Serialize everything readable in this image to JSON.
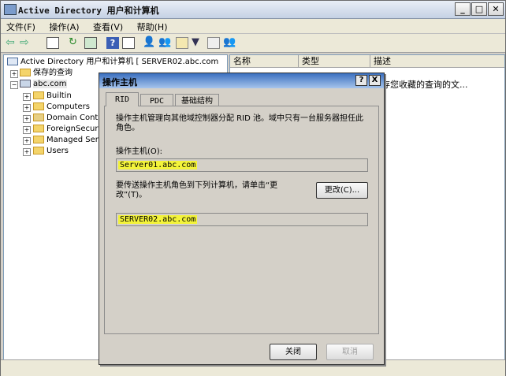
{
  "window": {
    "title": "Active Directory 用户和计算机"
  },
  "menu": [
    "文件(F)",
    "操作(A)",
    "查看(V)",
    "帮助(H)"
  ],
  "tree": {
    "root": "Active Directory 用户和计算机 [ SERVER02.abc.com",
    "saved_queries": "保存的查询",
    "domain": "abc.com",
    "children": [
      "Builtin",
      "Computers",
      "Domain Contr",
      "ForeignSecur",
      "Managed Serv",
      "Users"
    ]
  },
  "list": {
    "columns": [
      "名称",
      "类型",
      "描述"
    ],
    "row_desc": "存您收藏的查询的文..."
  },
  "dialog": {
    "title": "操作主机",
    "help_btn": "?",
    "close_btn": "X",
    "tabs": [
      "RID",
      "PDC",
      "基础结构"
    ],
    "description": "操作主机管理向其他域控制器分配 RID 池。域中只有一台服务器担任此角色。",
    "master_label": "操作主机(O):",
    "master_value": "Server01.abc.com",
    "transfer_text": "要传送操作主机角色到下列计算机，请单击“更改”(T)。",
    "change_button": "更改(C)...",
    "target_value": "SERVER02.abc.com",
    "close_button": "关闭",
    "cancel_button": "取消"
  }
}
